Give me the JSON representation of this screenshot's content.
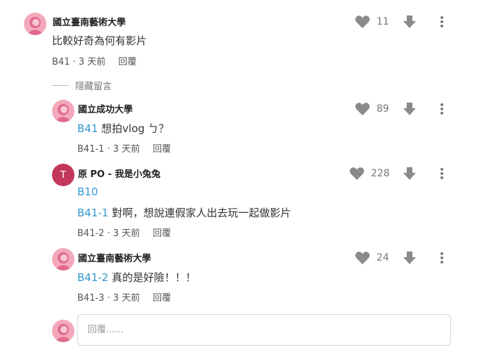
{
  "comments": [
    {
      "author": "國立臺南藝術大學",
      "text": "比較好奇為何有影片",
      "likes": "11",
      "floor": "B41",
      "time": "3 天前",
      "reply": "回覆"
    },
    {
      "author": "國立成功大學",
      "ref": "B41",
      "text": " 想拍vlog ㄅ？",
      "likes": "89",
      "floor": "B41-1",
      "time": "3 天前",
      "reply": "回覆"
    },
    {
      "author": "原 PO - 我是小兔兔",
      "avatar_letter": "T",
      "ref_line": "B10",
      "ref": "B41-1",
      "text": " 對啊，想說連假家人出去玩一起做影片",
      "likes": "228",
      "floor": "B41-2",
      "time": "3 天前",
      "reply": "回覆"
    },
    {
      "author": "國立臺南藝術大學",
      "ref": "B41-2",
      "text": " 真的是好險！！！",
      "likes": "24",
      "floor": "B41-3",
      "time": "3 天前",
      "reply": "回覆"
    }
  ],
  "hide_label": "隱藏留言",
  "meta_separator": " · ",
  "reply_input": {
    "placeholder": "回覆......"
  },
  "colors": {
    "accent": "#3397cf",
    "avatar_pink": "#ec8fa6",
    "avatar_op": "#c2385c"
  }
}
